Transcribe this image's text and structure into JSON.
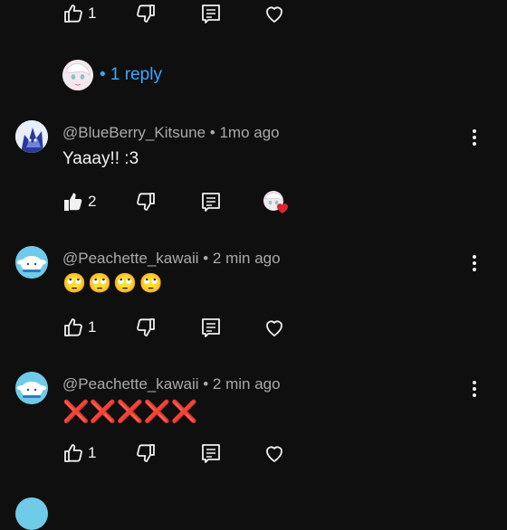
{
  "top_actions": {
    "like_count": "1"
  },
  "replies": {
    "label": "• 1 reply"
  },
  "comments": [
    {
      "user": "@BlueBerry_Kitsune",
      "time": "• 1mo ago",
      "text": "Yaaay!! :3",
      "like_count": "2",
      "creator_heart": true
    },
    {
      "user": "@Peachette_kawaii",
      "time": "• 2 min ago",
      "emoji": "🙄🙄🙄🙄",
      "like_count": "1"
    },
    {
      "user": "@Peachette_kawaii",
      "time": "• 2 min ago",
      "emoji": "❌❌❌❌❌",
      "like_count": "1"
    }
  ],
  "colors": {
    "background": "#0f0f0f",
    "link": "#3ea6ff",
    "meta": "#aaaaaa",
    "heart_badge": "#e0242f"
  }
}
